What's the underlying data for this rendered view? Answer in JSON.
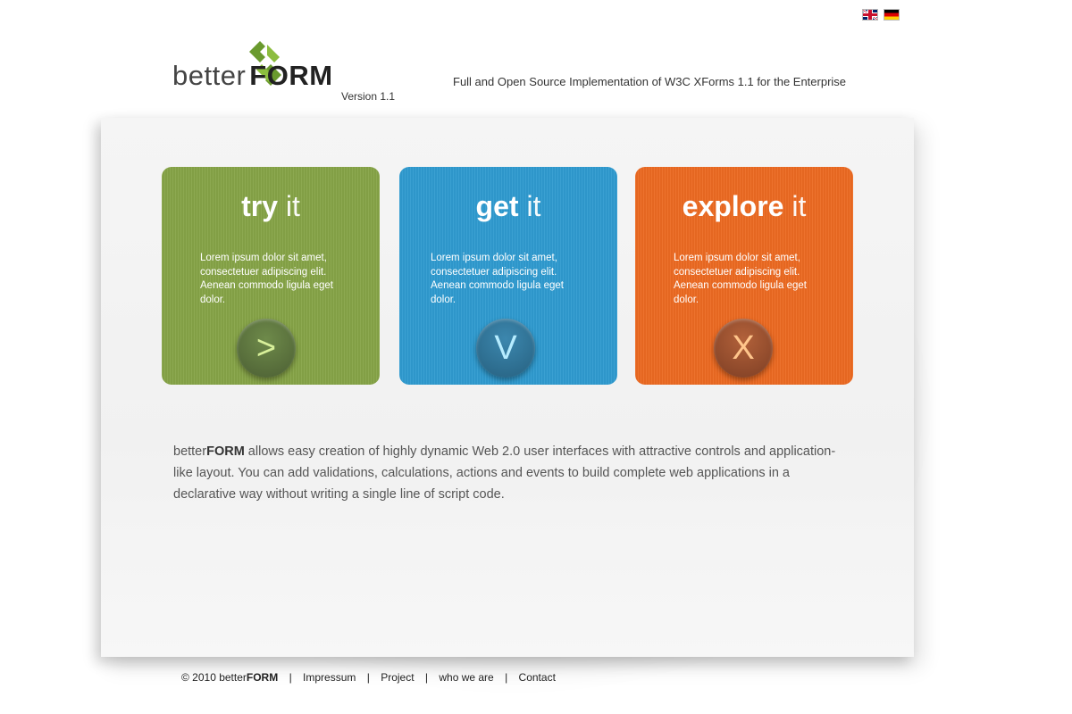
{
  "header": {
    "flags": [
      {
        "name": "english-flag-icon"
      },
      {
        "name": "german-flag-icon"
      }
    ],
    "logo": {
      "better": "better",
      "form": "FORM",
      "version": "Version 1.1",
      "accent_color": "#6a9a2e"
    },
    "tagline": "Full and Open Source Implementation of W3C XForms 1.1 for the Enterprise"
  },
  "cards": [
    {
      "title_strong": "try",
      "title_light": "it",
      "text": "Lorem ipsum dolor sit amet, consectetuer adipiscing elit. Aenean commodo ligula eget dolor.",
      "button": ">",
      "color": "#86a447"
    },
    {
      "title_strong": "get",
      "title_light": "it",
      "text": "Lorem ipsum dolor sit amet, consectetuer adipiscing elit. Aenean commodo ligula eget dolor.",
      "button": "V",
      "color": "#2f9bd0"
    },
    {
      "title_strong": "explore",
      "title_light": "it",
      "text": "Lorem ipsum dolor sit amet, consectetuer adipiscing elit. Aenean commodo ligula eget dolor.",
      "button": "X",
      "color": "#ec6a22"
    }
  ],
  "description": {
    "brand_light": "better",
    "brand_strong": "FORM",
    "text": " allows easy creation of highly dynamic Web 2.0 user interfaces with attractive controls and application-like layout. You can add validations, calculations, actions and events to build complete web applications in a declarative way without writing a single line of script code."
  },
  "footer": {
    "copyright_prefix": "© 2010 better",
    "copyright_strong": "FORM",
    "separator": "|",
    "links": [
      "Impressum",
      "Project",
      "who we are",
      "Contact"
    ]
  }
}
